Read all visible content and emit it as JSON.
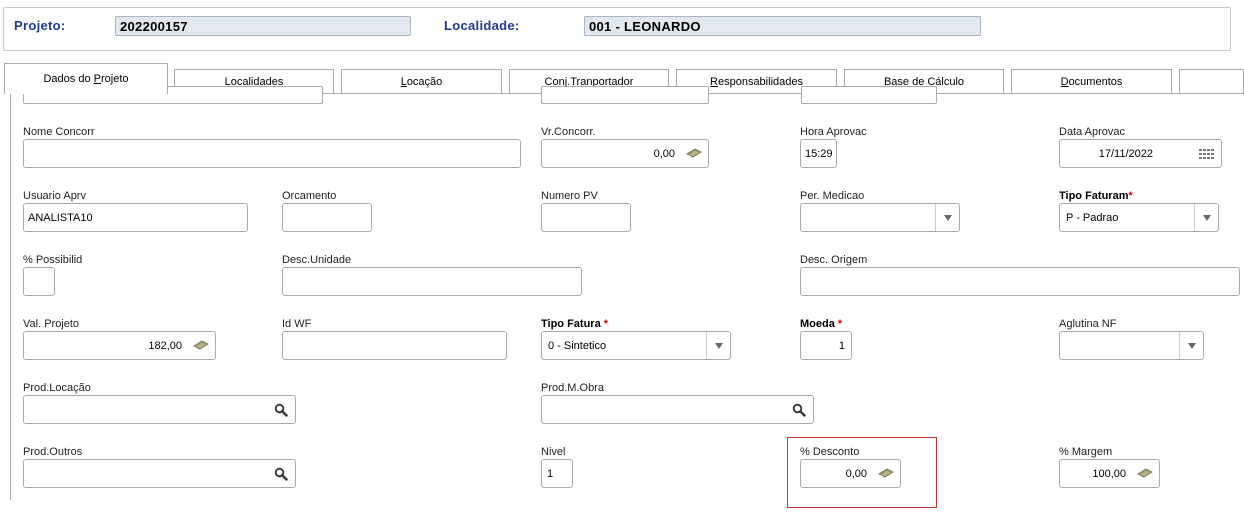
{
  "header": {
    "projeto_label": "Projeto:",
    "projeto_value": "202200157",
    "localidade_label": "Localidade:",
    "localidade_value": "001 - LEONARDO"
  },
  "tabs": [
    {
      "pre": "Dados do ",
      "key": "P",
      "post": "rojeto",
      "active": true
    },
    {
      "pre": "L",
      "key": "o",
      "post": "calidades"
    },
    {
      "pre": "",
      "key": "L",
      "post": "ocação"
    },
    {
      "pre": "Con",
      "key": "j",
      "post": ".Tranportador"
    },
    {
      "pre": "",
      "key": "R",
      "post": "esponsabilidades"
    },
    {
      "pre": "",
      "key": "B",
      "post": "ase de Cálculo"
    },
    {
      "pre": "",
      "key": "D",
      "post": "ocumentos"
    },
    {
      "pre": "",
      "key": "",
      "post": ""
    }
  ],
  "form": {
    "nome_concorr": {
      "label": "Nome Concorr",
      "value": ""
    },
    "vr_concorr": {
      "label": "Vr.Concorr.",
      "value": "0,00"
    },
    "hora_aprovac": {
      "label": "Hora Aprovac",
      "value": "15:29"
    },
    "data_aprovac": {
      "label": "Data Aprovac",
      "value": "17/11/2022"
    },
    "usuario_aprv": {
      "label": "Usuario Aprv",
      "value": "ANALISTA10"
    },
    "orcamento": {
      "label": "Orcamento",
      "value": ""
    },
    "numero_pv": {
      "label": "Numero PV",
      "value": ""
    },
    "per_medicao": {
      "label": "Per. Medicao",
      "value": ""
    },
    "tipo_faturam": {
      "label": "Tipo Faturam",
      "required": "*",
      "value": "P - Padrao"
    },
    "possibilid": {
      "label": "% Possibilid",
      "value": ""
    },
    "desc_unidade": {
      "label": "Desc.Unidade",
      "value": ""
    },
    "desc_origem": {
      "label": "Desc. Origem",
      "value": ""
    },
    "val_projeto": {
      "label": "Val. Projeto",
      "value": "182,00"
    },
    "id_wf": {
      "label": "Id WF",
      "value": ""
    },
    "tipo_fatura": {
      "label": "Tipo Fatura",
      "required": "*",
      "value": "0 - Sintetico"
    },
    "moeda": {
      "label": "Moeda",
      "required": "*",
      "value": "1"
    },
    "aglutina_nf": {
      "label": "Aglutina NF",
      "value": ""
    },
    "prod_locacao": {
      "label": "Prod.Locação",
      "value": ""
    },
    "prod_mobra": {
      "label": "Prod.M.Obra",
      "value": ""
    },
    "prod_outros": {
      "label": "Prod.Outros",
      "value": ""
    },
    "nivel": {
      "label": "Nivel",
      "value": "1"
    },
    "desconto": {
      "label": "% Desconto",
      "value": "0,00"
    },
    "margem": {
      "label": "% Margem",
      "value": "100,00"
    }
  },
  "icons": {
    "money": "money-icon",
    "search": "search-icon",
    "calendar": "calendar-icon",
    "dropdown": "chevron-down-icon"
  },
  "colors": {
    "header_label": "#1f3a93",
    "required": "#dd0000",
    "highlight": "#c8312b"
  }
}
